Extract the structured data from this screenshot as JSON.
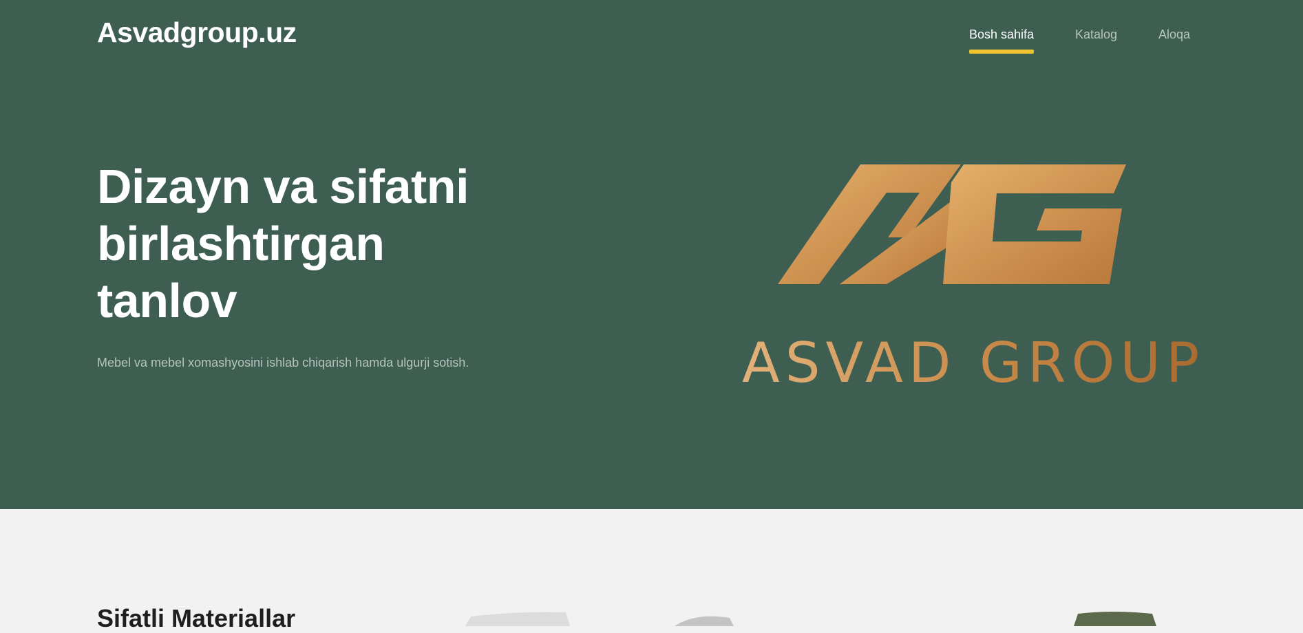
{
  "header": {
    "brand": "Asvadgroup.uz",
    "nav": [
      {
        "label": "Bosh sahifa",
        "active": true
      },
      {
        "label": "Katalog",
        "active": false
      },
      {
        "label": "Aloqa",
        "active": false
      }
    ]
  },
  "hero": {
    "title": "Dizayn va sifatni birlashtirgan tanlov",
    "subtitle": "Mebel va mebel xomashyosini ishlab chiqarish hamda ulgurji sotish.",
    "logo_text": "ASVAD GROUP"
  },
  "section": {
    "title": "Sifatli Materiallar"
  },
  "colors": {
    "hero_bg": "#3d5e51",
    "accent": "#f1c232",
    "gold": "#c98f4f"
  }
}
